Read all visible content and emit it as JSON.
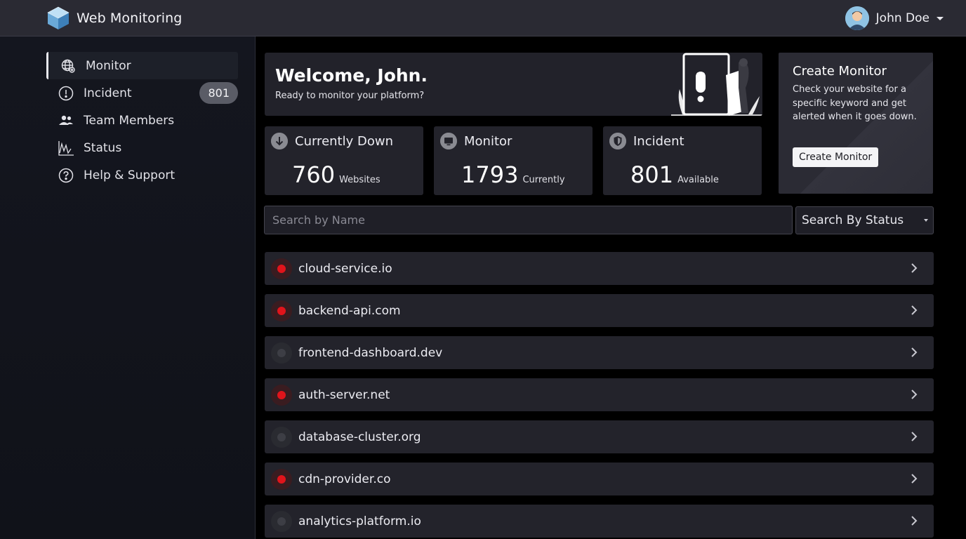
{
  "app": {
    "title": "Web Monitoring",
    "user_name": "John Doe"
  },
  "sidebar": {
    "items": [
      {
        "label": "Monitor",
        "icon": "globe-icon",
        "active": true
      },
      {
        "label": "Incident",
        "icon": "alert-circle-icon",
        "badge": "801"
      },
      {
        "label": "Team Members",
        "icon": "people-icon"
      },
      {
        "label": "Status",
        "icon": "status-chart-icon"
      },
      {
        "label": "Help & Support",
        "icon": "help-circle-icon"
      }
    ]
  },
  "welcome": {
    "title": "Welcome, John.",
    "subtitle": "Ready to monitor your platform?"
  },
  "create_monitor": {
    "title": "Create Monitor",
    "description": "Check your website for a specific keyword and get alerted when it goes down.",
    "button_label": "Create Monitor"
  },
  "stats": [
    {
      "label": "Currently Down",
      "value": "760",
      "unit": "Websites",
      "icon": "down-arrow-icon"
    },
    {
      "label": "Monitor",
      "value": "1793",
      "unit": "Currently",
      "icon": "monitor-icon"
    },
    {
      "label": "Incident",
      "value": "801",
      "unit": "Available",
      "icon": "shield-icon"
    }
  ],
  "filters": {
    "search_placeholder": "Search by Name",
    "status_label": "Search By Status"
  },
  "monitors": [
    {
      "name": "cloud-service.io",
      "status": "down"
    },
    {
      "name": "backend-api.com",
      "status": "down"
    },
    {
      "name": "frontend-dashboard.dev",
      "status": "inactive"
    },
    {
      "name": "auth-server.net",
      "status": "down"
    },
    {
      "name": "database-cluster.org",
      "status": "inactive"
    },
    {
      "name": "cdn-provider.co",
      "status": "down"
    },
    {
      "name": "analytics-platform.io",
      "status": "inactive"
    }
  ],
  "colors": {
    "status_down": "#e0141b",
    "status_inactive": "#3d3e45",
    "accent": "#f4f4f6"
  }
}
